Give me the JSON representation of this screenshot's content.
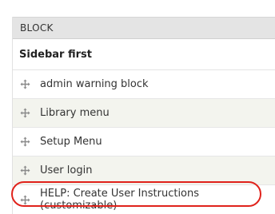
{
  "table": {
    "header": "BLOCK",
    "region_title": "Sidebar first",
    "rows": [
      {
        "label": "admin warning block"
      },
      {
        "label": "Library menu"
      },
      {
        "label": "Setup Menu"
      },
      {
        "label": "User login"
      },
      {
        "label": "HELP: Create User Instructions (customizable)"
      }
    ]
  },
  "icons": {
    "drag_handle": "move-arrows-icon"
  },
  "colors": {
    "header_bg": "#e4e4e4",
    "stripe_bg": "#f3f4ee",
    "highlight_ring": "#e0221b"
  }
}
